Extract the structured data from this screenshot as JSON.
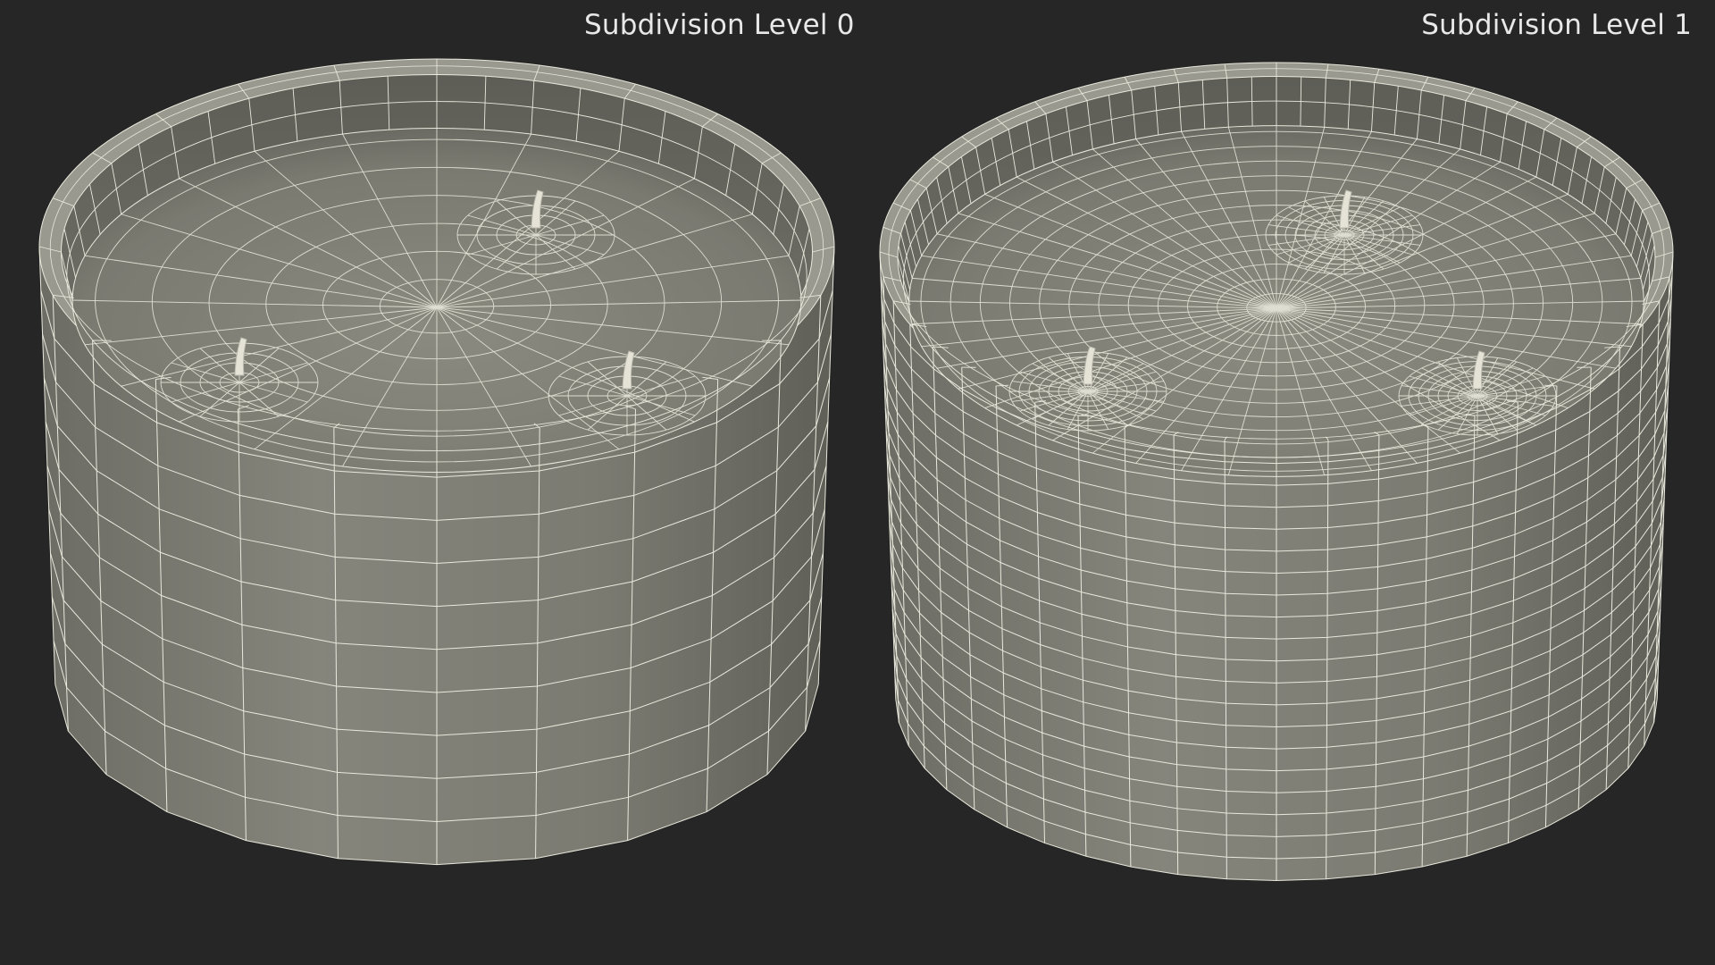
{
  "labels": {
    "left": "Subdivision Level 0",
    "right": "Subdivision Level 1"
  },
  "colors": {
    "background": "#262626",
    "surface": "#7a7a72",
    "wire": "#e9e8dc",
    "text": "#e8e8e8"
  },
  "models": [
    {
      "name": "candle-tin-subdivision-0",
      "radial_segments": 24,
      "wall_rows": 10,
      "floor_rings": 6,
      "wicks": 3
    },
    {
      "name": "candle-tin-subdivision-1",
      "radial_segments": 48,
      "wall_rows": 20,
      "floor_rings": 12,
      "wicks": 3
    }
  ]
}
